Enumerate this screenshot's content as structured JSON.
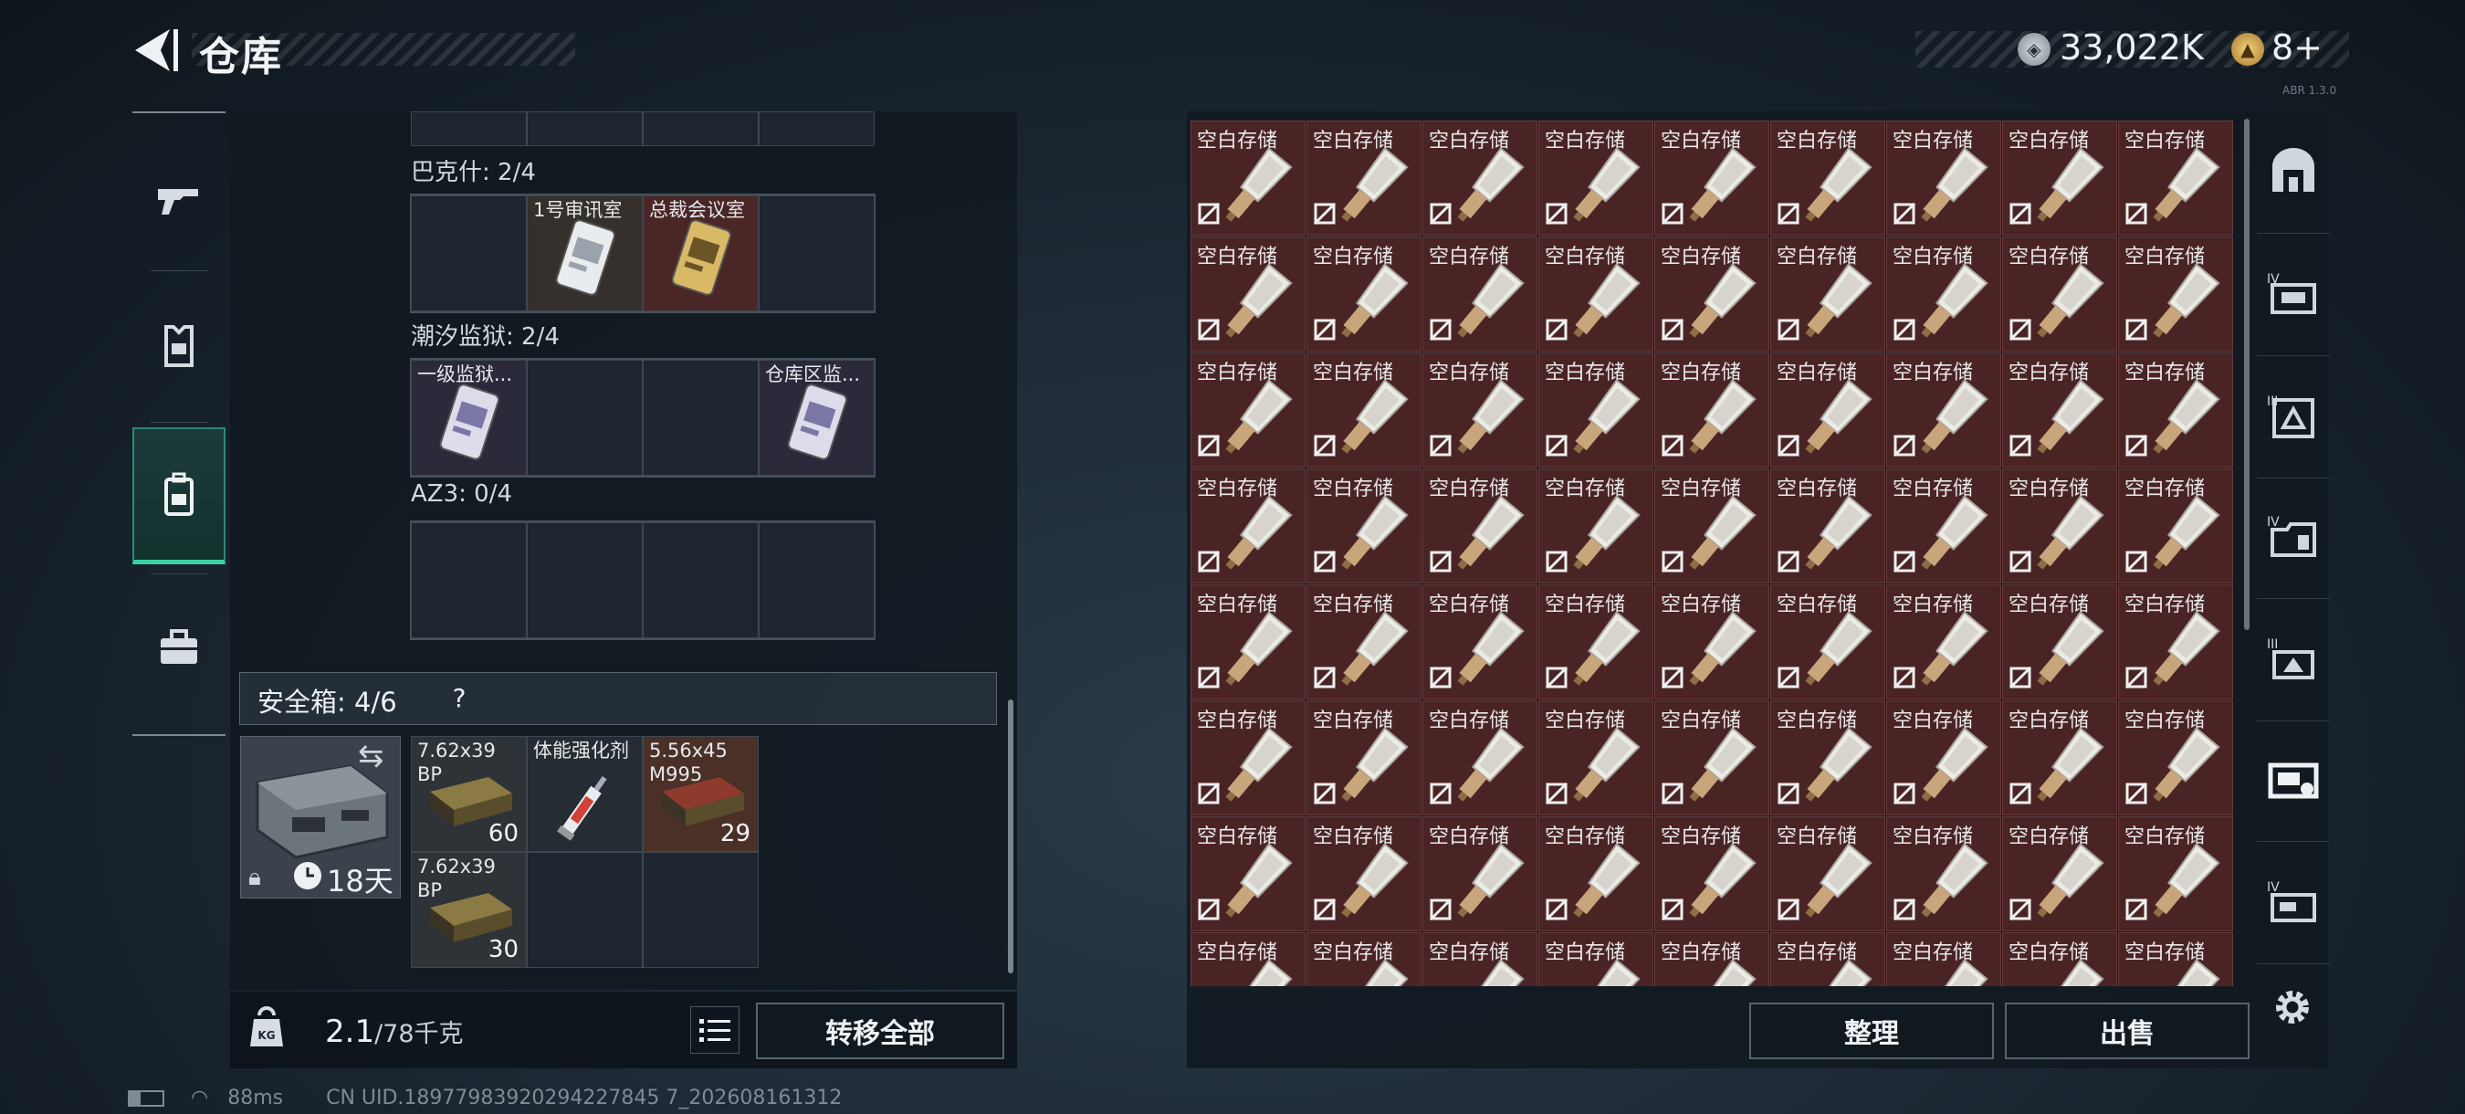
{
  "header": {
    "title": "仓库",
    "currency": "33,022K",
    "level": "8+",
    "tiny_text": "ABR 1.3.0"
  },
  "left_nav": [
    {
      "name": "weapon",
      "icon": "gun-icon"
    },
    {
      "name": "armor",
      "icon": "vest-icon"
    },
    {
      "name": "backpack",
      "icon": "backpack-icon"
    },
    {
      "name": "case",
      "icon": "briefcase-icon"
    }
  ],
  "keys": {
    "groups": [
      {
        "label": "巴克什: 2/4",
        "slots": [
          {
            "name": "",
            "color": "#1d262f"
          },
          {
            "name": "1号审讯室",
            "color": "#35302b",
            "card": "silver"
          },
          {
            "name": "总裁会议室",
            "color": "#4a2626",
            "card": "gold"
          },
          {
            "name": "",
            "color": "#1d262f"
          }
        ]
      },
      {
        "label": "潮汐监狱: 2/4",
        "slots": [
          {
            "name": "一级监狱...",
            "color": "#2b2a3a",
            "card": "violet"
          },
          {
            "name": "",
            "color": "#1d262f"
          },
          {
            "name": "",
            "color": "#1d262f"
          },
          {
            "name": "仓库区监...",
            "color": "#2b2a3a",
            "card": "violet"
          }
        ]
      },
      {
        "label": "AZ3: 0/4",
        "slots": [
          {
            "name": "",
            "color": "#1d262f"
          },
          {
            "name": "",
            "color": "#1d262f"
          },
          {
            "name": "",
            "color": "#1d262f"
          },
          {
            "name": "",
            "color": "#1d262f"
          }
        ]
      }
    ]
  },
  "safe_box": {
    "label": "安全箱: 4/6",
    "help": "?",
    "duration": "18天",
    "items": [
      {
        "name": "7.62x39\nBP",
        "count": "60",
        "kind": "ammo",
        "color": "#2e3338"
      },
      {
        "name": "体能强化剂",
        "count": "",
        "kind": "syringe",
        "color": "#262c33"
      },
      {
        "name": "5.56x45\nM995",
        "count": "29",
        "kind": "ammo-red",
        "color": "#4a3027"
      },
      {
        "name": "7.62x39\nBP",
        "count": "30",
        "kind": "ammo",
        "color": "#2e3338"
      },
      {
        "name": "",
        "count": "",
        "kind": "empty",
        "color": "#1d262f"
      },
      {
        "name": "",
        "count": "",
        "kind": "empty",
        "color": "#1d262f"
      }
    ]
  },
  "footer_left": {
    "weight": "2.1",
    "weight_max": "/78千克",
    "transfer_label": "转移全部"
  },
  "status": {
    "ping": "88ms",
    "uid": "CN UID.18977983920294227845 7_202608161312"
  },
  "stash": {
    "item_label": "空白存储",
    "columns": 9,
    "rows": 8,
    "cell_color": "#4a2425"
  },
  "right_nav": [
    {
      "icon": "arena-icon"
    },
    {
      "icon": "tier-iv-card-icon"
    },
    {
      "icon": "tier-iii-card-icon"
    },
    {
      "icon": "tier-iv-folder-icon"
    },
    {
      "icon": "tier-iii-device-icon"
    },
    {
      "icon": "storage-device-icon"
    },
    {
      "icon": "tier-iv-device-icon"
    }
  ],
  "footer_right": {
    "sort_label": "整理",
    "sell_label": "出售"
  }
}
